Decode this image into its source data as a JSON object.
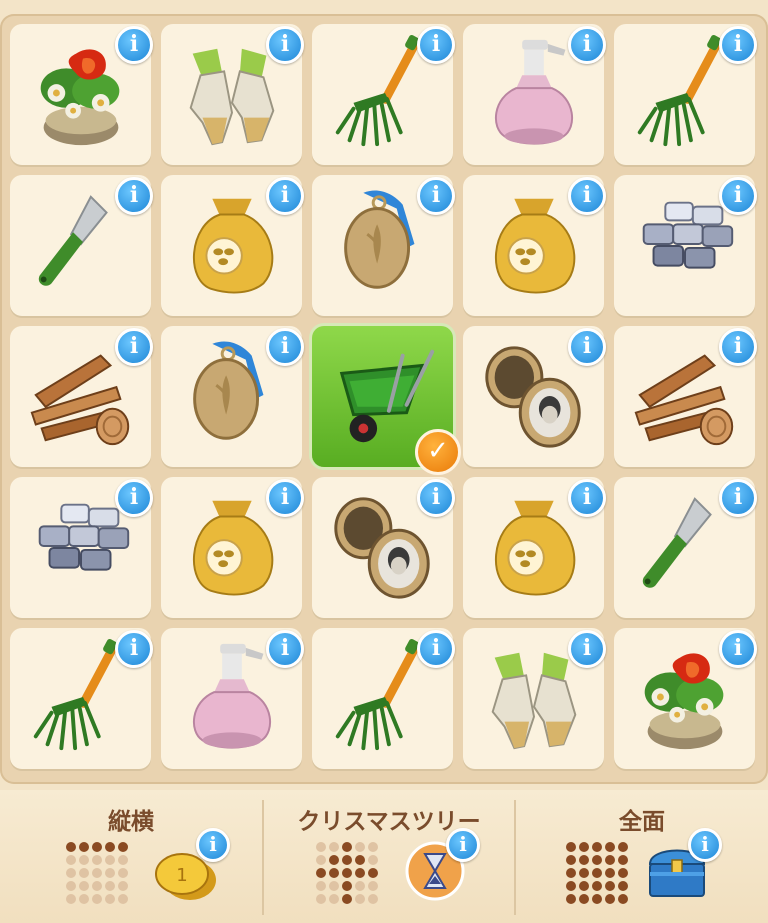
{
  "grid": [
    [
      "flower-pot",
      "gloves",
      "rake",
      "spray-bottle",
      "rake"
    ],
    [
      "trowel",
      "seed-bag",
      "locket-closed",
      "seed-bag",
      "stones"
    ],
    [
      "planks",
      "locket-closed",
      "wheelbarrow",
      "locket-open",
      "planks"
    ],
    [
      "stones",
      "seed-bag",
      "locket-open",
      "seed-bag",
      "trowel"
    ],
    [
      "rake",
      "spray-bottle",
      "rake",
      "gloves",
      "flower-pot"
    ]
  ],
  "selected_cell": {
    "row": 2,
    "col": 2
  },
  "info_symbol": "i",
  "check_symbol": "✓",
  "rewards": [
    {
      "title": "縦横",
      "reward_icon": "gold-coins-icon",
      "pattern": [
        [
          1,
          1,
          1,
          1,
          1
        ],
        [
          0,
          0,
          0,
          0,
          0
        ],
        [
          0,
          0,
          0,
          0,
          0
        ],
        [
          0,
          0,
          0,
          0,
          0
        ],
        [
          0,
          0,
          0,
          0,
          0
        ]
      ]
    },
    {
      "title": "クリスマスツリー",
      "reward_icon": "hourglass-icon",
      "pattern": [
        [
          0,
          0,
          1,
          0,
          0
        ],
        [
          0,
          1,
          1,
          1,
          0
        ],
        [
          1,
          1,
          1,
          1,
          1
        ],
        [
          0,
          0,
          1,
          0,
          0
        ],
        [
          0,
          0,
          1,
          0,
          0
        ]
      ]
    },
    {
      "title": "全面",
      "reward_icon": "treasure-chest-icon",
      "pattern": [
        [
          1,
          1,
          1,
          1,
          1
        ],
        [
          1,
          1,
          1,
          1,
          1
        ],
        [
          1,
          1,
          1,
          1,
          1
        ],
        [
          1,
          1,
          1,
          1,
          1
        ],
        [
          1,
          1,
          1,
          1,
          1
        ]
      ]
    }
  ],
  "colors": {
    "selected": "#6cc232",
    "info": "#1d86d6",
    "check": "#f08a12",
    "dot_on": "#8a4a22",
    "dot_off": "#dfc3a3"
  }
}
